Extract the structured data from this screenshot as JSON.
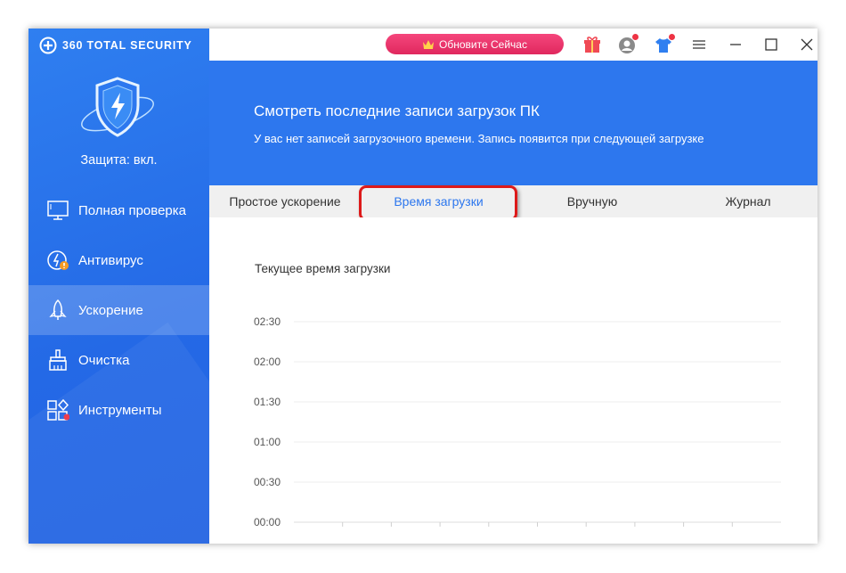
{
  "app": {
    "brand": "360 TOTAL SECURITY",
    "protection_status": "Защита: вкл.",
    "upgrade_button": "Обновите Сейчас"
  },
  "sidebar": {
    "items": [
      {
        "label": "Полная проверка",
        "icon": "monitor-icon"
      },
      {
        "label": "Антивирус",
        "icon": "antivirus-icon"
      },
      {
        "label": "Ускорение",
        "icon": "rocket-icon",
        "active": true
      },
      {
        "label": "Очистка",
        "icon": "broom-icon"
      },
      {
        "label": "Инструменты",
        "icon": "tools-grid-icon"
      }
    ]
  },
  "banner": {
    "title": "Смотреть последние записи загрузок ПК",
    "subtitle": "У вас нет записей загрузочного времени. Запись появится при следующей загрузке"
  },
  "tabs": [
    {
      "label": "Простое ускорение"
    },
    {
      "label": "Время загрузки",
      "active": true
    },
    {
      "label": "Вручную"
    },
    {
      "label": "Журнал"
    }
  ],
  "colors": {
    "accent": "#2d77ee",
    "sidebar": "#2469e6",
    "upgrade": "#e8346a",
    "highlight": "#dd1a1a"
  },
  "chart_data": {
    "type": "line",
    "title": "Текущее время загрузки",
    "y_tick_labels": [
      "00:00",
      "00:30",
      "01:00",
      "01:30",
      "02:00",
      "02:30"
    ],
    "ylim": [
      "00:00",
      "02:30"
    ],
    "x_tick_count": 10,
    "series": [],
    "grid": true
  }
}
